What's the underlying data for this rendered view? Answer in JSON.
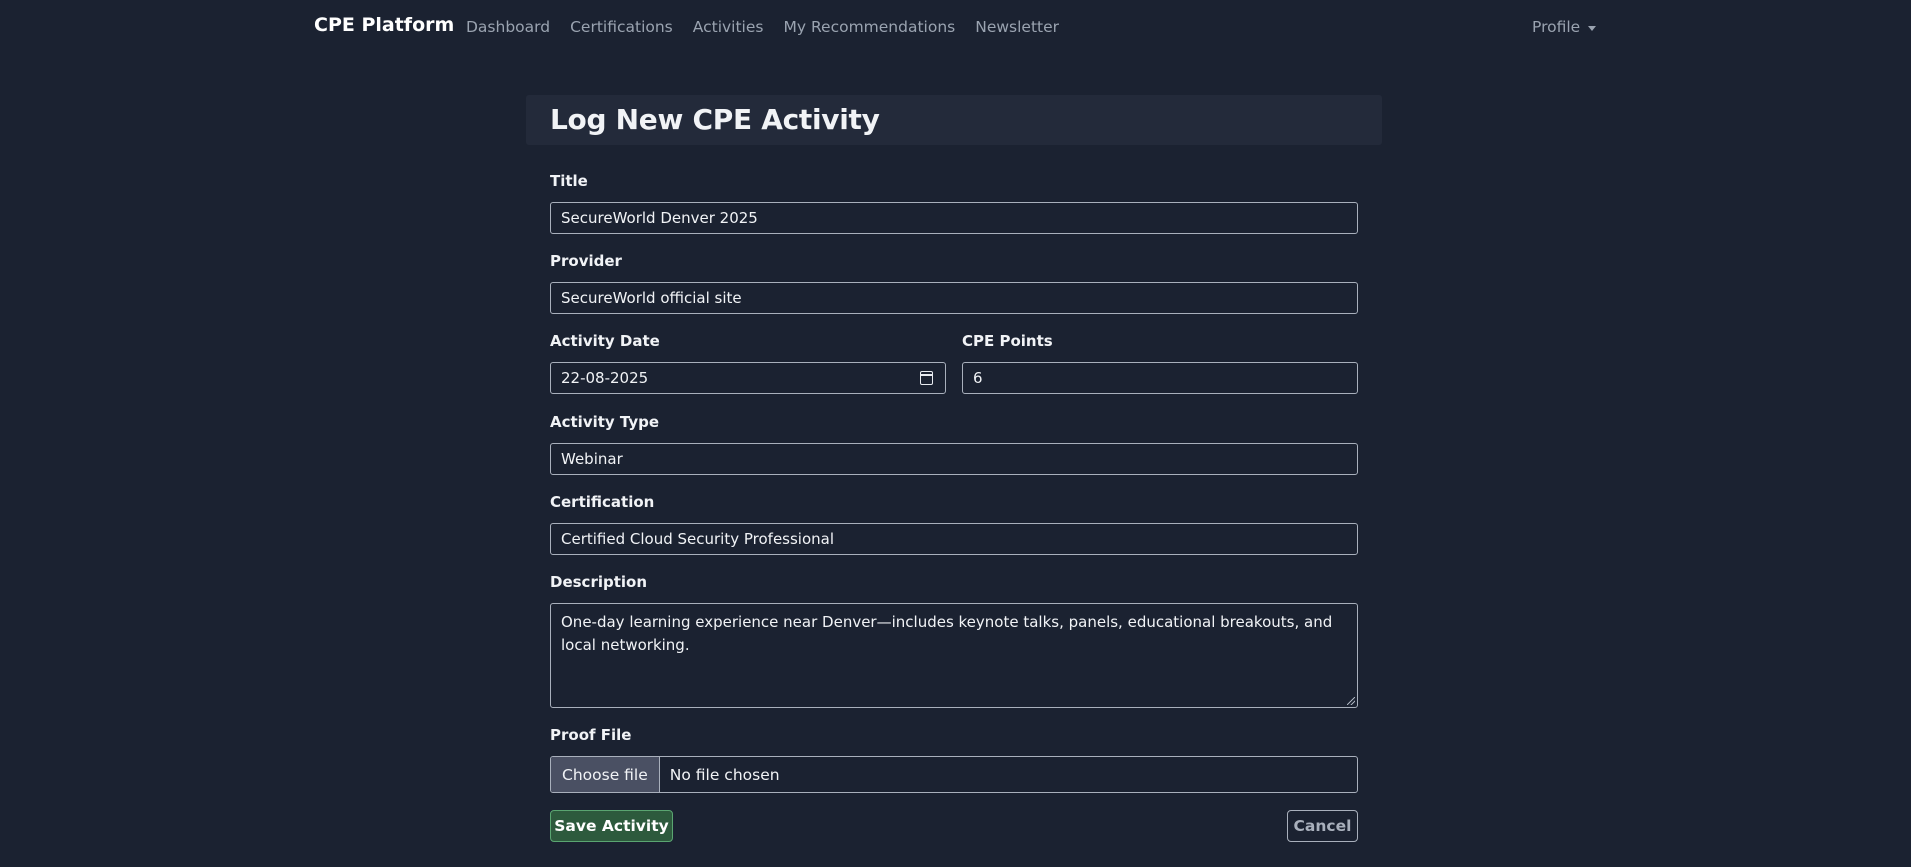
{
  "navbar": {
    "brand": "CPE Platform",
    "links": [
      "Dashboard",
      "Certifications",
      "Activities",
      "My Recommendations",
      "Newsletter"
    ],
    "profile": "Profile"
  },
  "form": {
    "heading": "Log New CPE Activity",
    "title": {
      "label": "Title",
      "value": "SecureWorld Denver 2025"
    },
    "provider": {
      "label": "Provider",
      "value": "SecureWorld official site"
    },
    "activity_date": {
      "label": "Activity Date",
      "value": "22-08-2025"
    },
    "cpe_points": {
      "label": "CPE Points",
      "value": "6"
    },
    "activity_type": {
      "label": "Activity Type",
      "value": "Webinar"
    },
    "certification": {
      "label": "Certification",
      "value": "Certified Cloud Security Professional"
    },
    "description": {
      "label": "Description",
      "value": "One-day learning experience near Denver—includes keynote talks, panels, educational breakouts, and local networking."
    },
    "proof_file": {
      "label": "Proof File",
      "button": "Choose file",
      "status": "No file chosen"
    },
    "save_label": "Save Activity",
    "cancel_label": "Cancel"
  },
  "colors": {
    "background": "#1b2231",
    "header_card": "#232a3a",
    "save_button": "#2d5a3d",
    "save_border": "#5aa571",
    "border": "#a9b0bc",
    "muted_text": "#9aa3b0"
  }
}
